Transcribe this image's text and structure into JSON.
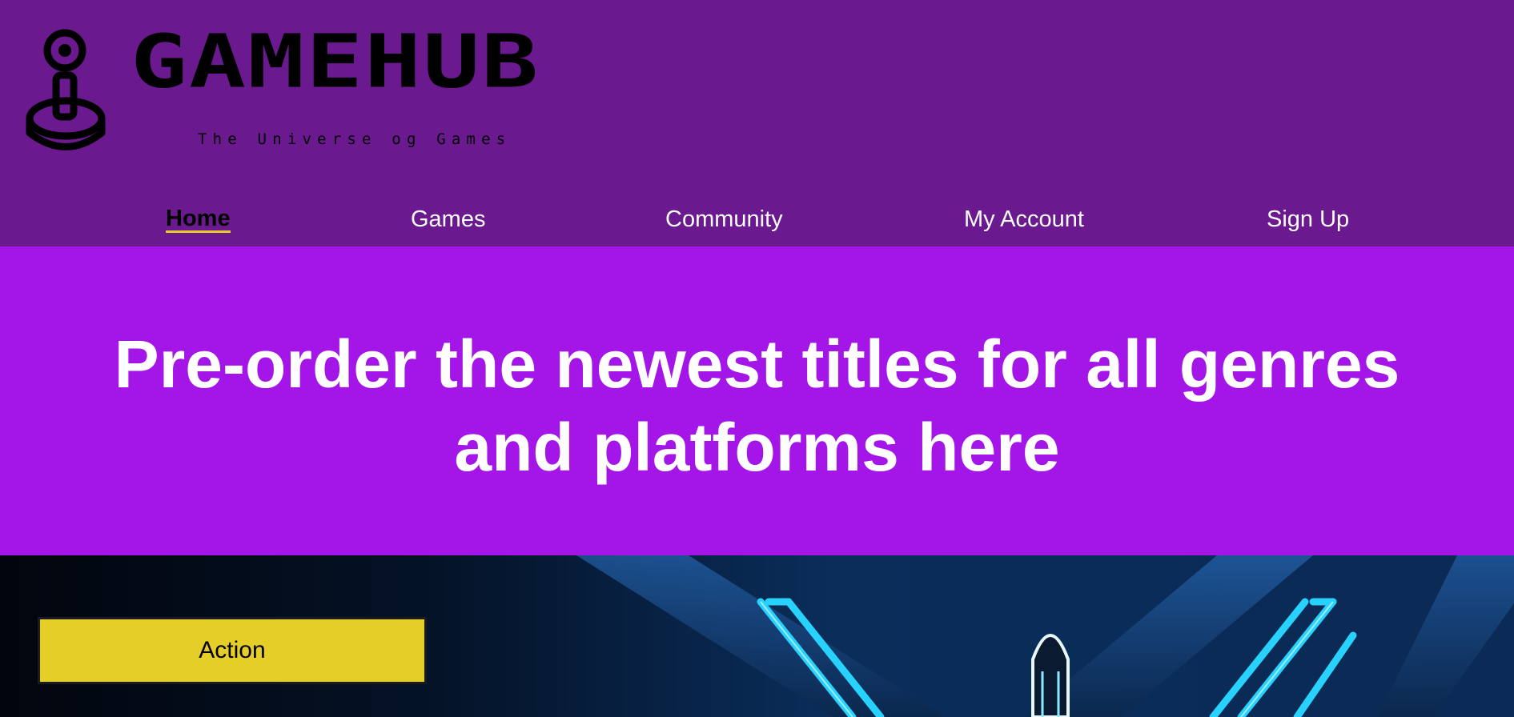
{
  "brand": {
    "name": "GAMEHUB",
    "tagline": "The Universe og Games",
    "logo_icon": "joystick-icon"
  },
  "nav": {
    "items": [
      {
        "label": "Home",
        "active": true
      },
      {
        "label": "Games",
        "active": false
      },
      {
        "label": "Community",
        "active": false
      },
      {
        "label": "My Account",
        "active": false
      },
      {
        "label": "Sign Up",
        "active": false
      }
    ]
  },
  "hero": {
    "line1": "Pre-order the newest titles for all genres",
    "line2": "and platforms here"
  },
  "banner": {
    "genre_label": "Action",
    "image": "neon-game-artwork"
  },
  "colors": {
    "header_bg": "#6a198f",
    "hero_bg": "#a415e8",
    "accent_yellow": "#e6ce28",
    "neon_cyan": "#27d2ff"
  }
}
